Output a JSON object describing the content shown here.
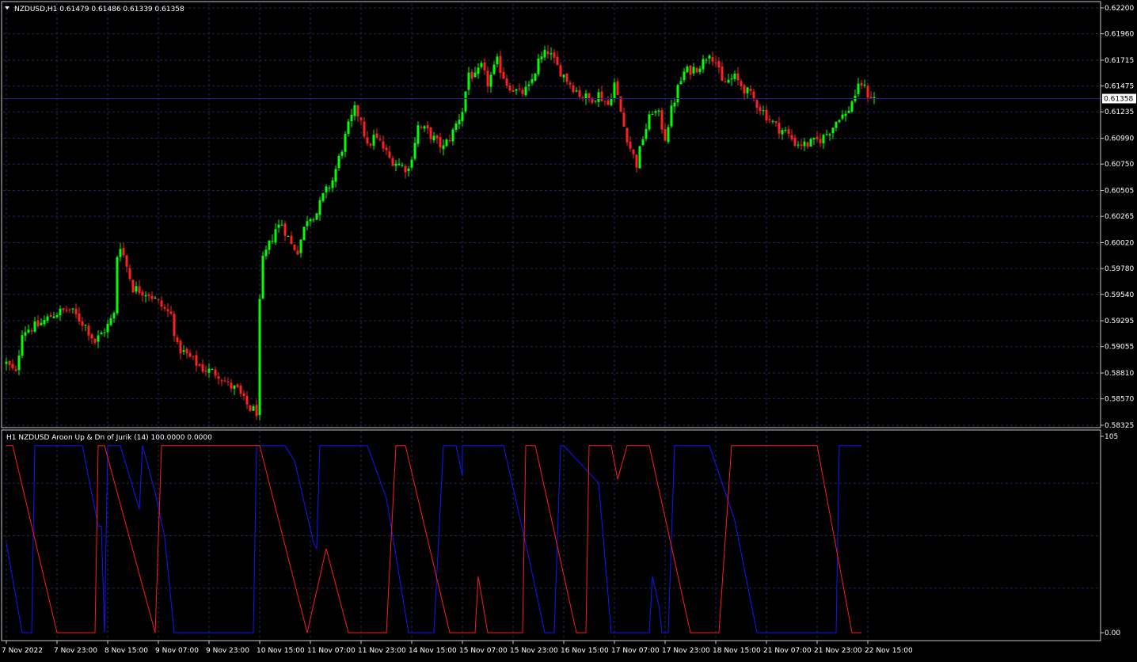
{
  "colors": {
    "background": "#000000",
    "frame": "#c8c8c8",
    "grid": "#232356",
    "text": "#ffffff",
    "bull_candle": "#00ff00",
    "bear_candle": "#ff2020",
    "aroon_up": "#1414ff",
    "aroon_down": "#ff1a1a",
    "price_line": "#1e1e8c"
  },
  "header": {
    "symbol_label": "NZDUSD,H1  0.61479 0.61486 0.61339 0.61358",
    "indicator_label": "H1 NZDUSD Aroon Up & Dn of Jurik (14) 100.0000 0.0000"
  },
  "current_price": {
    "value": 0.61358,
    "label": "0.61358"
  },
  "chart_data": [
    {
      "type": "candlestick",
      "title": "NZDUSD,H1",
      "ylim": [
        0.5832,
        0.6222
      ],
      "y_ticks": [
        "0.62200",
        "0.61960",
        "0.61715",
        "0.61475",
        "0.61235",
        "0.60990",
        "0.60750",
        "0.60505",
        "0.60265",
        "0.60020",
        "0.59780",
        "0.59540",
        "0.59295",
        "0.59055",
        "0.58810",
        "0.58570",
        "0.58325"
      ],
      "x_ticks": [
        "7 Nov 2022",
        "7 Nov 23:00",
        "8 Nov 15:00",
        "9 Nov 07:00",
        "9 Nov 23:00",
        "10 Nov 15:00",
        "11 Nov 07:00",
        "11 Nov 23:00",
        "14 Nov 15:00",
        "15 Nov 07:00",
        "15 Nov 23:00",
        "16 Nov 15:00",
        "17 Nov 07:00",
        "17 Nov 23:00",
        "18 Nov 15:00",
        "21 Nov 07:00",
        "21 Nov 23:00",
        "22 Nov 15:00"
      ],
      "bars_per_x_tick": 16,
      "close_path": [
        [
          0,
          0.589
        ],
        [
          3,
          0.588
        ],
        [
          5,
          0.592
        ],
        [
          10,
          0.5925
        ],
        [
          15,
          0.5936
        ],
        [
          20,
          0.594
        ],
        [
          25,
          0.5925
        ],
        [
          28,
          0.591
        ],
        [
          32,
          0.5925
        ],
        [
          34,
          0.5935
        ],
        [
          35,
          0.599
        ],
        [
          36,
          0.6
        ],
        [
          38,
          0.598
        ],
        [
          40,
          0.596
        ],
        [
          45,
          0.5955
        ],
        [
          50,
          0.594
        ],
        [
          52,
          0.5935
        ],
        [
          54,
          0.5905
        ],
        [
          58,
          0.5895
        ],
        [
          62,
          0.5885
        ],
        [
          67,
          0.588
        ],
        [
          70,
          0.587
        ],
        [
          73,
          0.5865
        ],
        [
          75,
          0.5855
        ],
        [
          77,
          0.5848
        ],
        [
          79,
          0.5845
        ],
        [
          80,
          0.5945
        ],
        [
          81,
          0.5985
        ],
        [
          83,
          0.6
        ],
        [
          85,
          0.6015
        ],
        [
          87,
          0.602
        ],
        [
          90,
          0.6
        ],
        [
          92,
          0.5995
        ],
        [
          95,
          0.6025
        ],
        [
          98,
          0.603
        ],
        [
          100,
          0.6045
        ],
        [
          103,
          0.606
        ],
        [
          105,
          0.608
        ],
        [
          108,
          0.611
        ],
        [
          110,
          0.6125
        ],
        [
          112,
          0.6118
        ],
        [
          114,
          0.609
        ],
        [
          116,
          0.61
        ],
        [
          118,
          0.6095
        ],
        [
          121,
          0.608
        ],
        [
          124,
          0.6075
        ],
        [
          127,
          0.607
        ],
        [
          130,
          0.611
        ],
        [
          133,
          0.6105
        ],
        [
          136,
          0.6095
        ],
        [
          138,
          0.609
        ],
        [
          141,
          0.6105
        ],
        [
          144,
          0.6125
        ],
        [
          146,
          0.616
        ],
        [
          148,
          0.6155
        ],
        [
          150,
          0.6165
        ],
        [
          152,
          0.615
        ],
        [
          155,
          0.617
        ],
        [
          158,
          0.615
        ],
        [
          162,
          0.614
        ],
        [
          165,
          0.6145
        ],
        [
          168,
          0.617
        ],
        [
          171,
          0.618
        ],
        [
          174,
          0.6165
        ],
        [
          178,
          0.615
        ],
        [
          181,
          0.614
        ],
        [
          184,
          0.6135
        ],
        [
          187,
          0.614
        ],
        [
          190,
          0.613
        ],
        [
          192,
          0.615
        ],
        [
          195,
          0.611
        ],
        [
          197,
          0.609
        ],
        [
          199,
          0.6075
        ],
        [
          201,
          0.61
        ],
        [
          204,
          0.6125
        ],
        [
          206,
          0.612
        ],
        [
          208,
          0.61
        ],
        [
          210,
          0.6125
        ],
        [
          212,
          0.6145
        ],
        [
          214,
          0.616
        ],
        [
          218,
          0.6165
        ],
        [
          220,
          0.617
        ],
        [
          222,
          0.618
        ],
        [
          224,
          0.617
        ],
        [
          226,
          0.615
        ],
        [
          230,
          0.6155
        ],
        [
          233,
          0.6145
        ],
        [
          236,
          0.6135
        ],
        [
          240,
          0.612
        ],
        [
          243,
          0.611
        ],
        [
          246,
          0.6105
        ],
        [
          249,
          0.6095
        ],
        [
          252,
          0.6093
        ],
        [
          255,
          0.6095
        ],
        [
          258,
          0.61
        ],
        [
          261,
          0.611
        ],
        [
          263,
          0.612
        ],
        [
          265,
          0.612
        ],
        [
          268,
          0.614
        ],
        [
          270,
          0.615
        ],
        [
          272,
          0.614
        ],
        [
          274,
          0.6136
        ]
      ]
    },
    {
      "type": "line",
      "title": "H1 NZDUSD Aroon Up & Dn of Jurik (14)",
      "ylim": [
        0,
        105
      ],
      "y_ticks": [
        "105",
        "0.00"
      ],
      "series": [
        {
          "name": "Aroon Up",
          "color": "#1414ff",
          "points": [
            [
              0,
              48
            ],
            [
              5,
              0
            ],
            [
              8,
              0
            ],
            [
              9,
              100
            ],
            [
              15,
              100
            ],
            [
              20,
              100
            ],
            [
              24,
              100
            ],
            [
              29,
              57
            ],
            [
              30,
              57
            ],
            [
              31,
              0
            ],
            [
              32,
              100
            ],
            [
              35,
              100
            ],
            [
              36,
              100
            ],
            [
              42,
              66
            ],
            [
              43,
              100
            ],
            [
              47,
              75
            ],
            [
              50,
              51
            ],
            [
              53,
              0
            ],
            [
              57,
              0
            ],
            [
              60,
              0
            ],
            [
              65,
              0
            ],
            [
              70,
              0
            ],
            [
              78,
              0
            ],
            [
              79,
              100
            ],
            [
              83,
              100
            ],
            [
              88,
              100
            ],
            [
              91,
              92
            ],
            [
              97,
              48
            ],
            [
              98,
              45
            ],
            [
              99,
              100
            ],
            [
              113,
              100
            ],
            [
              114,
              100
            ],
            [
              120,
              72
            ],
            [
              127,
              0
            ],
            [
              135,
              0
            ],
            [
              138,
              100
            ],
            [
              142,
              100
            ],
            [
              144,
              84
            ],
            [
              144,
              100
            ],
            [
              157,
              100
            ],
            [
              165,
              40
            ],
            [
              170,
              0
            ],
            [
              173,
              0
            ],
            [
              175,
              100
            ],
            [
              176,
              100
            ],
            [
              187,
              80
            ],
            [
              191,
              0
            ],
            [
              203,
              0
            ],
            [
              204,
              30
            ],
            [
              206,
              15
            ],
            [
              207,
              0
            ],
            [
              209,
              0
            ],
            [
              211,
              100
            ],
            [
              222,
              100
            ],
            [
              230,
              60
            ],
            [
              237,
              0
            ],
            [
              250,
              0
            ],
            [
              262,
              0
            ],
            [
              263,
              100
            ],
            [
              265,
              100
            ],
            [
              270,
              100
            ]
          ]
        },
        {
          "name": "Aroon Dn",
          "color": "#ff1a1a",
          "points": [
            [
              0,
              100
            ],
            [
              2,
              100
            ],
            [
              16,
              0
            ],
            [
              18,
              0
            ],
            [
              28,
              0
            ],
            [
              29,
              100
            ],
            [
              31,
              100
            ],
            [
              47,
              0
            ],
            [
              49,
              100
            ],
            [
              56,
              100
            ],
            [
              63,
              100
            ],
            [
              79,
              100
            ],
            [
              80,
              100
            ],
            [
              95,
              0
            ],
            [
              101,
              45
            ],
            [
              108,
              0
            ],
            [
              120,
              0
            ],
            [
              123,
              100
            ],
            [
              126,
              100
            ],
            [
              140,
              0
            ],
            [
              148,
              0
            ],
            [
              149,
              30
            ],
            [
              152,
              0
            ],
            [
              163,
              0
            ],
            [
              164,
              100
            ],
            [
              167,
              100
            ],
            [
              180,
              0
            ],
            [
              183,
              0
            ],
            [
              184,
              100
            ],
            [
              191,
              100
            ],
            [
              193,
              82
            ],
            [
              196,
              100
            ],
            [
              203,
              100
            ],
            [
              216,
              0
            ],
            [
              225,
              0
            ],
            [
              229,
              100
            ],
            [
              252,
              100
            ],
            [
              256,
              100
            ],
            [
              267,
              0
            ],
            [
              270,
              0
            ]
          ]
        }
      ]
    }
  ]
}
